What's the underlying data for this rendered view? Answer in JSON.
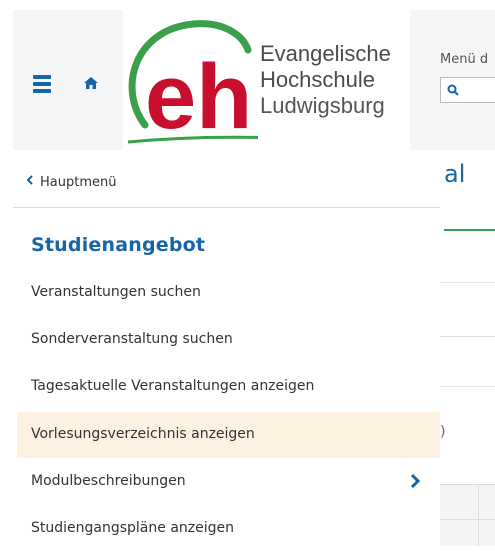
{
  "header": {
    "menu_icon": "hamburger-menu-icon",
    "home_icon": "home-icon",
    "logo": {
      "mark": "eh",
      "line1": "Evangelische",
      "line2": "Hochschule",
      "line3": "Ludwigsburg"
    },
    "menu_search_label": "Menü d",
    "search_icon": "search-icon"
  },
  "background": {
    "title_fragment": "al",
    "paren_fragment": ")"
  },
  "menu": {
    "back_label": "Hauptmenü",
    "section_title": "Studienangebot",
    "items": [
      {
        "label": "Veranstaltungen suchen"
      },
      {
        "label": "Sonderveranstaltung suchen"
      },
      {
        "label": "Tagesaktuelle Veranstaltungen anzeigen"
      },
      {
        "label": "Vorlesungsverzeichnis anzeigen",
        "highlighted": true
      },
      {
        "label": "Modulbeschreibungen",
        "has_submenu": true
      },
      {
        "label": "Studiengangspläne anzeigen"
      }
    ]
  },
  "colors": {
    "brand_blue": "#1565a8",
    "brand_red": "#c8102e",
    "brand_green": "#3aa14a",
    "highlight": "#fdf2e2"
  }
}
